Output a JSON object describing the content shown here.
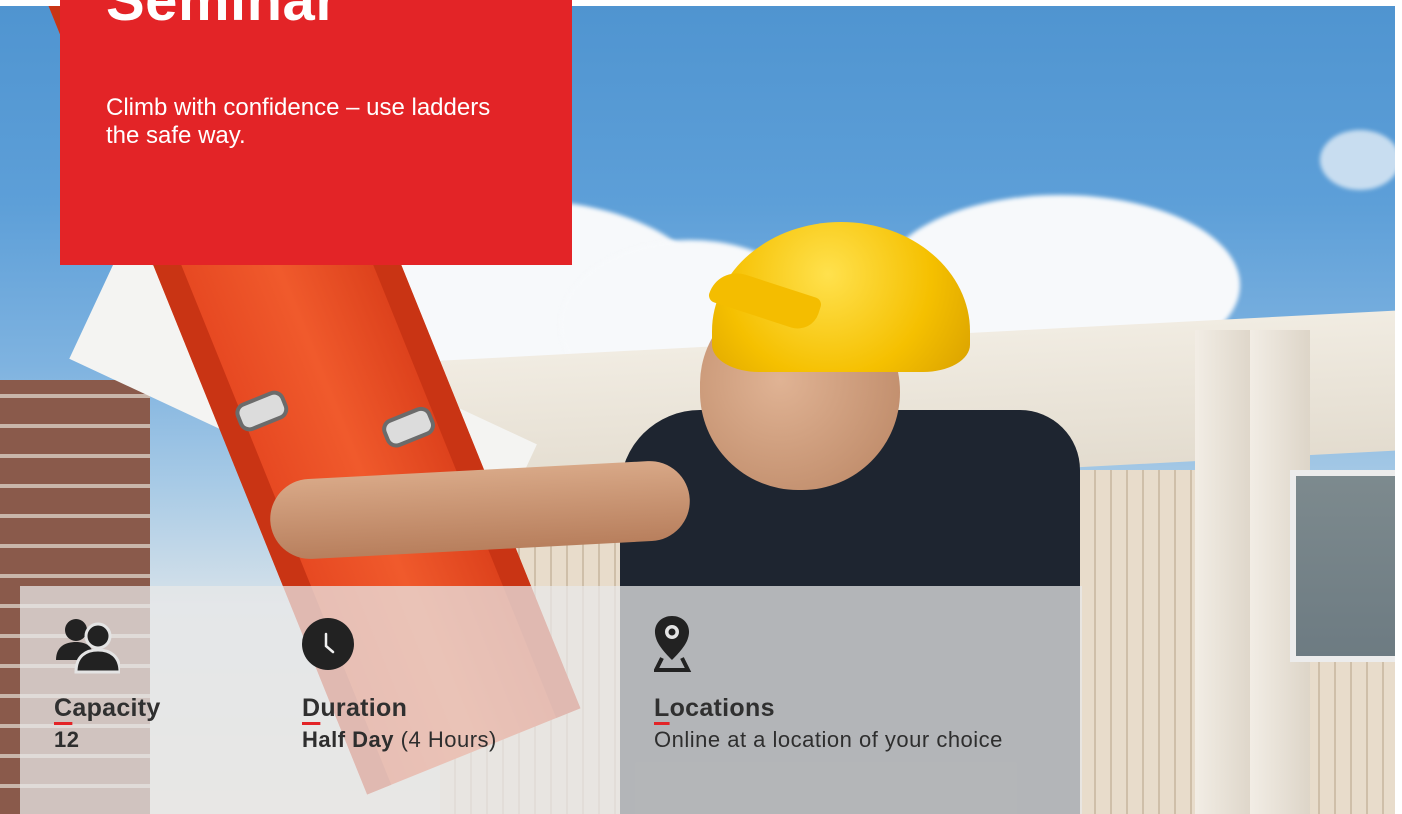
{
  "hero": {
    "photo": "construction-worker-on-ladder-photo",
    "accent_color": "#e32427"
  },
  "title_card": {
    "title": "Seminar",
    "tagline": "Climb with confidence – use ladders the safe way."
  },
  "info": {
    "capacity": {
      "icon": "users-icon",
      "label_first": "C",
      "label_rest": "apacity",
      "value": "12"
    },
    "duration": {
      "icon": "clock-icon",
      "label_first": "D",
      "label_rest": "uration",
      "value_bold": "Half Day",
      "value_rest": " (4 Hours)"
    },
    "locations": {
      "icon": "map-pin-icon",
      "label_first": "L",
      "label_rest": "ocations",
      "value": "Online at a location of your choice"
    }
  }
}
